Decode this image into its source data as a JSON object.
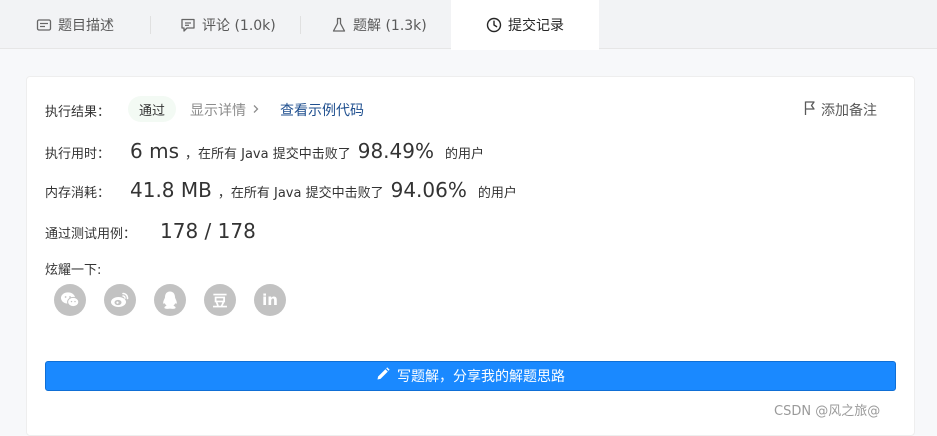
{
  "tabs": [
    {
      "label": "题目描述",
      "icon": "description-icon"
    },
    {
      "label": "评论 (1.0k)",
      "icon": "comment-icon"
    },
    {
      "label": "题解 (1.3k)",
      "icon": "flask-icon"
    },
    {
      "label": "提交记录",
      "icon": "clock-icon",
      "active": true
    }
  ],
  "result": {
    "label": "执行结果：",
    "status": "通过",
    "detail_link": "显示详情",
    "code_link": "查看示例代码",
    "note_button": "添加备注"
  },
  "runtime": {
    "label": "执行用时：",
    "value": "6 ms",
    "middle": "，在所有 Java 提交中击败了",
    "percent": "98.49%",
    "suffix": "的用户"
  },
  "memory": {
    "label": "内存消耗：",
    "value": "41.8 MB",
    "middle": "，在所有 Java 提交中击败了",
    "percent": "94.06%",
    "suffix": "的用户"
  },
  "tests": {
    "label": "通过测试用例：",
    "value": "178 / 178"
  },
  "share": {
    "label": "炫耀一下:",
    "icons": [
      "wechat-icon",
      "weibo-icon",
      "qq-icon",
      "douban-icon",
      "linkedin-icon"
    ],
    "douban_glyph": "豆",
    "linkedin_glyph": "in"
  },
  "write_button": "写题解，分享我的解题思路",
  "watermark": "CSDN @风之旅@",
  "colors": {
    "accent": "#1a89ff",
    "link": "#1f4f8f",
    "pass_bg": "#f3faf4",
    "share_icon": "#c2c2c2"
  }
}
